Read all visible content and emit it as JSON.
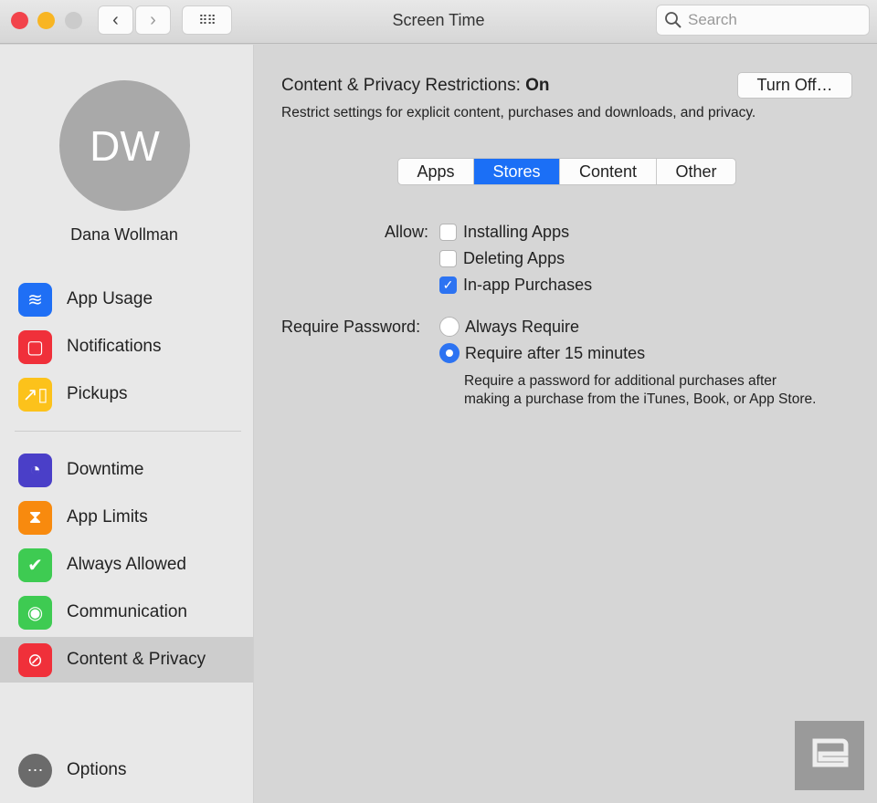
{
  "window": {
    "title": "Screen Time",
    "search_placeholder": "Search"
  },
  "user": {
    "initials": "DW",
    "name": "Dana Wollman"
  },
  "sidebar": {
    "items": [
      {
        "label": "App Usage",
        "icon": "layers-icon",
        "color": "#1f6ff5"
      },
      {
        "label": "Notifications",
        "icon": "notification-badge-icon",
        "color": "#f0303a"
      },
      {
        "label": "Pickups",
        "icon": "pickup-phone-icon",
        "color": "#fcc21b"
      },
      {
        "label": "Downtime",
        "icon": "downtime-clock-icon",
        "color": "#4a3fc8"
      },
      {
        "label": "App Limits",
        "icon": "hourglass-icon",
        "color": "#f88a0e"
      },
      {
        "label": "Always Allowed",
        "icon": "checkmark-seal-icon",
        "color": "#3ecb52"
      },
      {
        "label": "Communication",
        "icon": "person-circle-icon",
        "color": "#3ecb52"
      },
      {
        "label": "Content & Privacy",
        "icon": "prohibited-icon",
        "color": "#f0303a",
        "selected": true
      }
    ],
    "options_label": "Options"
  },
  "main": {
    "heading": "Content & Privacy Restrictions:",
    "status": "On",
    "description": "Restrict settings for explicit content, purchases and downloads, and privacy.",
    "turn_off_label": "Turn Off…",
    "tabs": [
      {
        "label": "Apps"
      },
      {
        "label": "Stores",
        "selected": true
      },
      {
        "label": "Content"
      },
      {
        "label": "Other"
      }
    ],
    "allow_label": "Allow:",
    "allow": [
      {
        "label": "Installing Apps",
        "checked": false
      },
      {
        "label": "Deleting Apps",
        "checked": false
      },
      {
        "label": "In-app Purchases",
        "checked": true
      }
    ],
    "password_label": "Require Password:",
    "password": [
      {
        "label": "Always Require",
        "selected": false
      },
      {
        "label": "Require after 15 minutes",
        "selected": true
      }
    ],
    "note": "Require a password for additional purchases after making a purchase from the iTunes, Book, or App Store."
  },
  "watermark": "engadget"
}
